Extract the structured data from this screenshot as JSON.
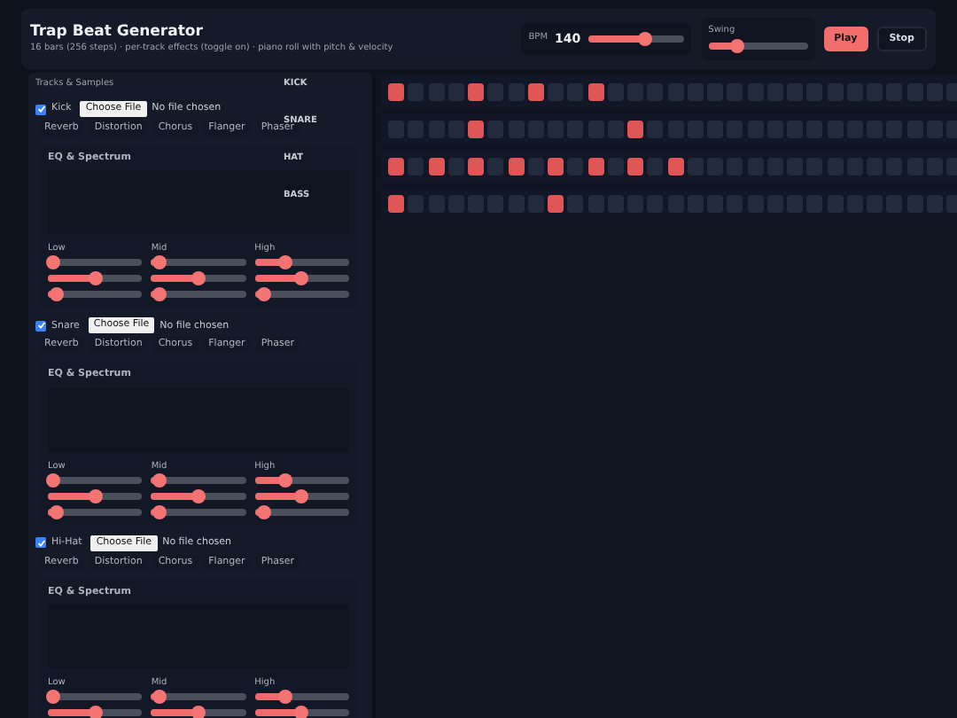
{
  "header": {
    "title": "Trap Beat Generator",
    "subtitle": "16 bars (256 steps) · per-track effects (toggle on) · piano roll with pitch & velocity",
    "bpm": {
      "label": "BPM",
      "value": "140",
      "level": 0.6
    },
    "swing": {
      "label": "Swing",
      "level": 0.3
    },
    "buttons": [
      {
        "label": "Play",
        "kind": "primary"
      },
      {
        "label": "Stop",
        "kind": "secondary"
      }
    ]
  },
  "tracks_panel": {
    "title": "Tracks & Samples",
    "tracks": [
      {
        "name": "Kick",
        "checked": true,
        "file_button": "Choose File",
        "file_status": "No file chosen",
        "effects": [
          "Reverb",
          "Distortion",
          "Chorus",
          "Flanger",
          "Phaser"
        ],
        "eq_title": "EQ & Spectrum",
        "bands": [
          {
            "label": "Low",
            "sliders": [
              {
                "level": 0.05
              },
              {
                "level": 0.5
              },
              {
                "level": 0.1
              }
            ]
          },
          {
            "label": "Mid",
            "sliders": [
              {
                "level": 0.08
              },
              {
                "level": 0.5
              },
              {
                "level": 0.08
              }
            ]
          },
          {
            "label": "High",
            "sliders": [
              {
                "level": 0.32
              },
              {
                "level": 0.5
              },
              {
                "level": 0.1
              }
            ]
          }
        ]
      },
      {
        "name": "Snare",
        "checked": true,
        "file_button": "Choose File",
        "file_status": "No file chosen",
        "effects": [
          "Reverb",
          "Distortion",
          "Chorus",
          "Flanger",
          "Phaser"
        ],
        "eq_title": "EQ & Spectrum",
        "bands": [
          {
            "label": "Low",
            "sliders": [
              {
                "level": 0.05
              },
              {
                "level": 0.5
              },
              {
                "level": 0.1
              }
            ]
          },
          {
            "label": "Mid",
            "sliders": [
              {
                "level": 0.08
              },
              {
                "level": 0.5
              },
              {
                "level": 0.08
              }
            ]
          },
          {
            "label": "High",
            "sliders": [
              {
                "level": 0.32
              },
              {
                "level": 0.5
              },
              {
                "level": 0.1
              }
            ]
          }
        ]
      },
      {
        "name": "Hi-Hat",
        "checked": true,
        "file_button": "Choose File",
        "file_status": "No file chosen",
        "effects": [
          "Reverb",
          "Distortion",
          "Chorus",
          "Flanger",
          "Phaser"
        ],
        "eq_title": "EQ & Spectrum",
        "bands": [
          {
            "label": "Low",
            "sliders": [
              {
                "level": 0.05
              },
              {
                "level": 0.5
              }
            ]
          },
          {
            "label": "Mid",
            "sliders": [
              {
                "level": 0.08
              },
              {
                "level": 0.5
              }
            ]
          },
          {
            "label": "High",
            "sliders": [
              {
                "level": 0.32
              },
              {
                "level": 0.5
              }
            ]
          }
        ]
      }
    ]
  },
  "sequencer": {
    "rows": [
      {
        "label": "KICK",
        "steps": [
          true,
          false,
          false,
          false,
          true,
          false,
          false,
          true,
          false,
          false,
          true,
          false,
          false,
          false,
          false,
          false,
          false,
          false,
          false,
          false,
          false,
          false,
          false,
          false,
          false,
          false,
          false,
          false,
          false
        ]
      },
      {
        "label": "SNARE",
        "steps": [
          false,
          false,
          false,
          false,
          true,
          false,
          false,
          false,
          false,
          false,
          false,
          false,
          true,
          false,
          false,
          false,
          false,
          false,
          false,
          false,
          false,
          false,
          false,
          false,
          false,
          false,
          false,
          false,
          false
        ]
      },
      {
        "label": "HAT",
        "steps": [
          true,
          false,
          true,
          false,
          true,
          false,
          true,
          false,
          true,
          false,
          true,
          false,
          true,
          false,
          true,
          false,
          false,
          false,
          false,
          false,
          false,
          false,
          false,
          false,
          false,
          false,
          false,
          false,
          false
        ]
      },
      {
        "label": "BASS",
        "steps": [
          true,
          false,
          false,
          false,
          false,
          false,
          false,
          false,
          true,
          false,
          false,
          false,
          false,
          false,
          false,
          false,
          false,
          false,
          false,
          false,
          false,
          false,
          false,
          false,
          false,
          false,
          false,
          false,
          false
        ]
      }
    ]
  }
}
